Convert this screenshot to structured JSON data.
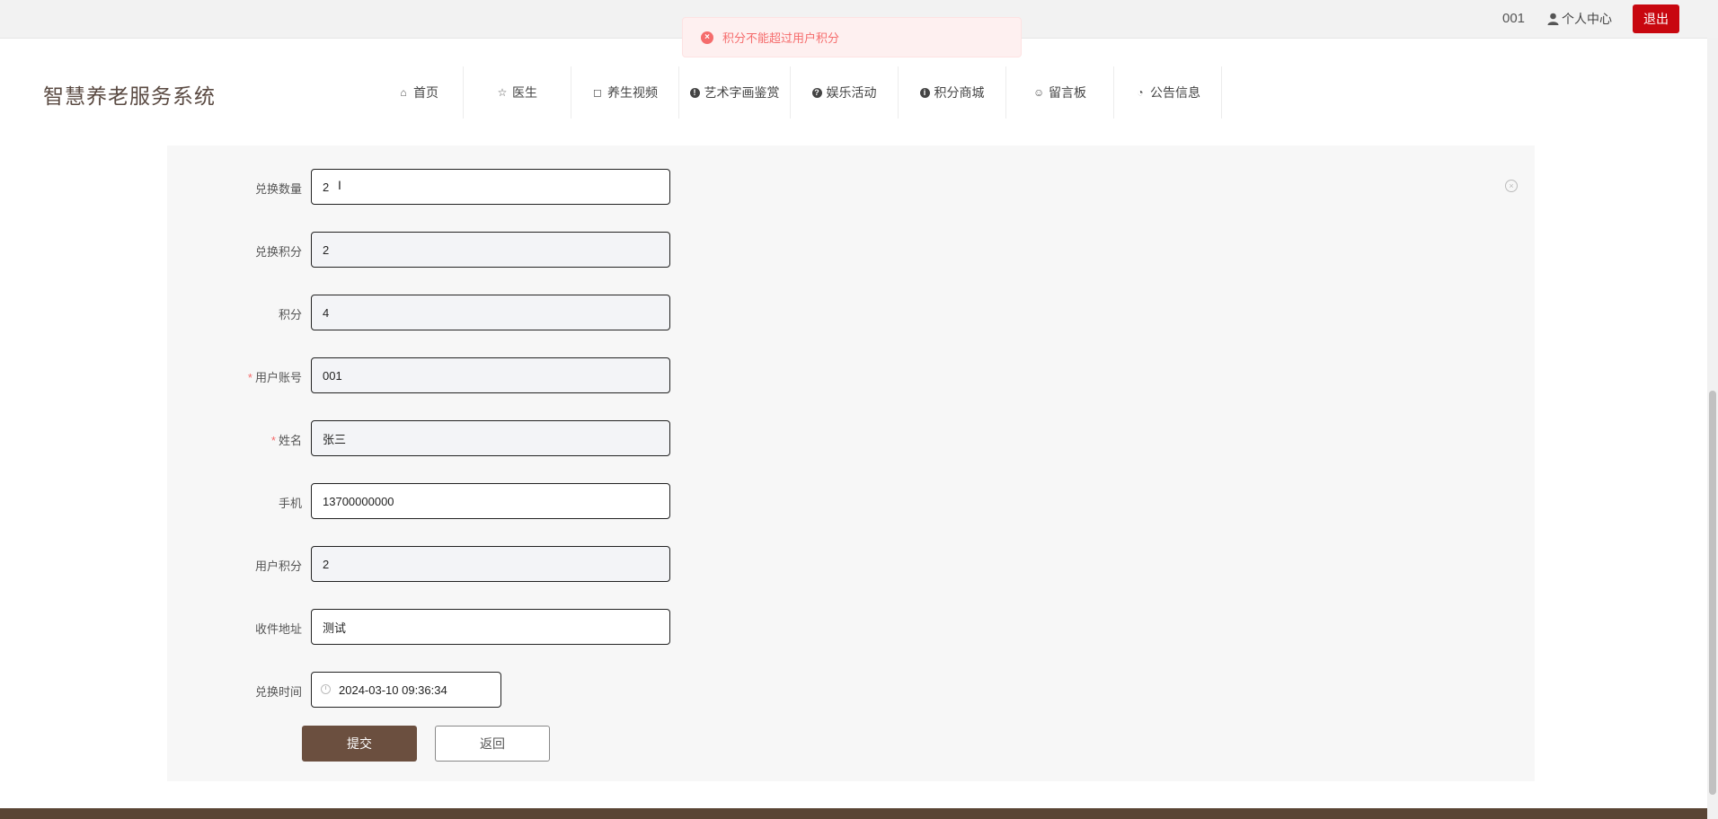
{
  "topbar": {
    "account": "001",
    "personal_center": "个人中心",
    "logout": "退出"
  },
  "toast": {
    "message": "积分不能超过用户积分"
  },
  "header": {
    "logo": "智慧养老服务系统",
    "nav": [
      {
        "label": "首页",
        "icon": "home-icon"
      },
      {
        "label": "医生",
        "icon": "star-icon"
      },
      {
        "label": "养生视频",
        "icon": "bag-icon"
      },
      {
        "label": "艺术字画鉴赏",
        "icon": "warning-icon"
      },
      {
        "label": "娱乐活动",
        "icon": "question-icon"
      },
      {
        "label": "积分商城",
        "icon": "info-icon"
      },
      {
        "label": "留言板",
        "icon": "smile-icon"
      },
      {
        "label": "公告信息",
        "icon": "chart-icon"
      }
    ]
  },
  "form": {
    "fields": [
      {
        "label": "兑换数量",
        "value": "2",
        "required": false
      },
      {
        "label": "兑换积分",
        "value": "2",
        "required": false
      },
      {
        "label": "积分",
        "value": "4",
        "required": false
      },
      {
        "label": "用户账号",
        "value": "001",
        "required": true
      },
      {
        "label": "姓名",
        "value": "张三",
        "required": true
      },
      {
        "label": "手机",
        "value": "13700000000",
        "required": false
      },
      {
        "label": "用户积分",
        "value": "2",
        "required": false
      },
      {
        "label": "收件地址",
        "value": "测试",
        "required": false
      },
      {
        "label": "兑换时间",
        "value": "2024-03-10 09:36:34",
        "required": false
      }
    ],
    "required_mark": "*",
    "submit": "提交",
    "back": "返回"
  }
}
